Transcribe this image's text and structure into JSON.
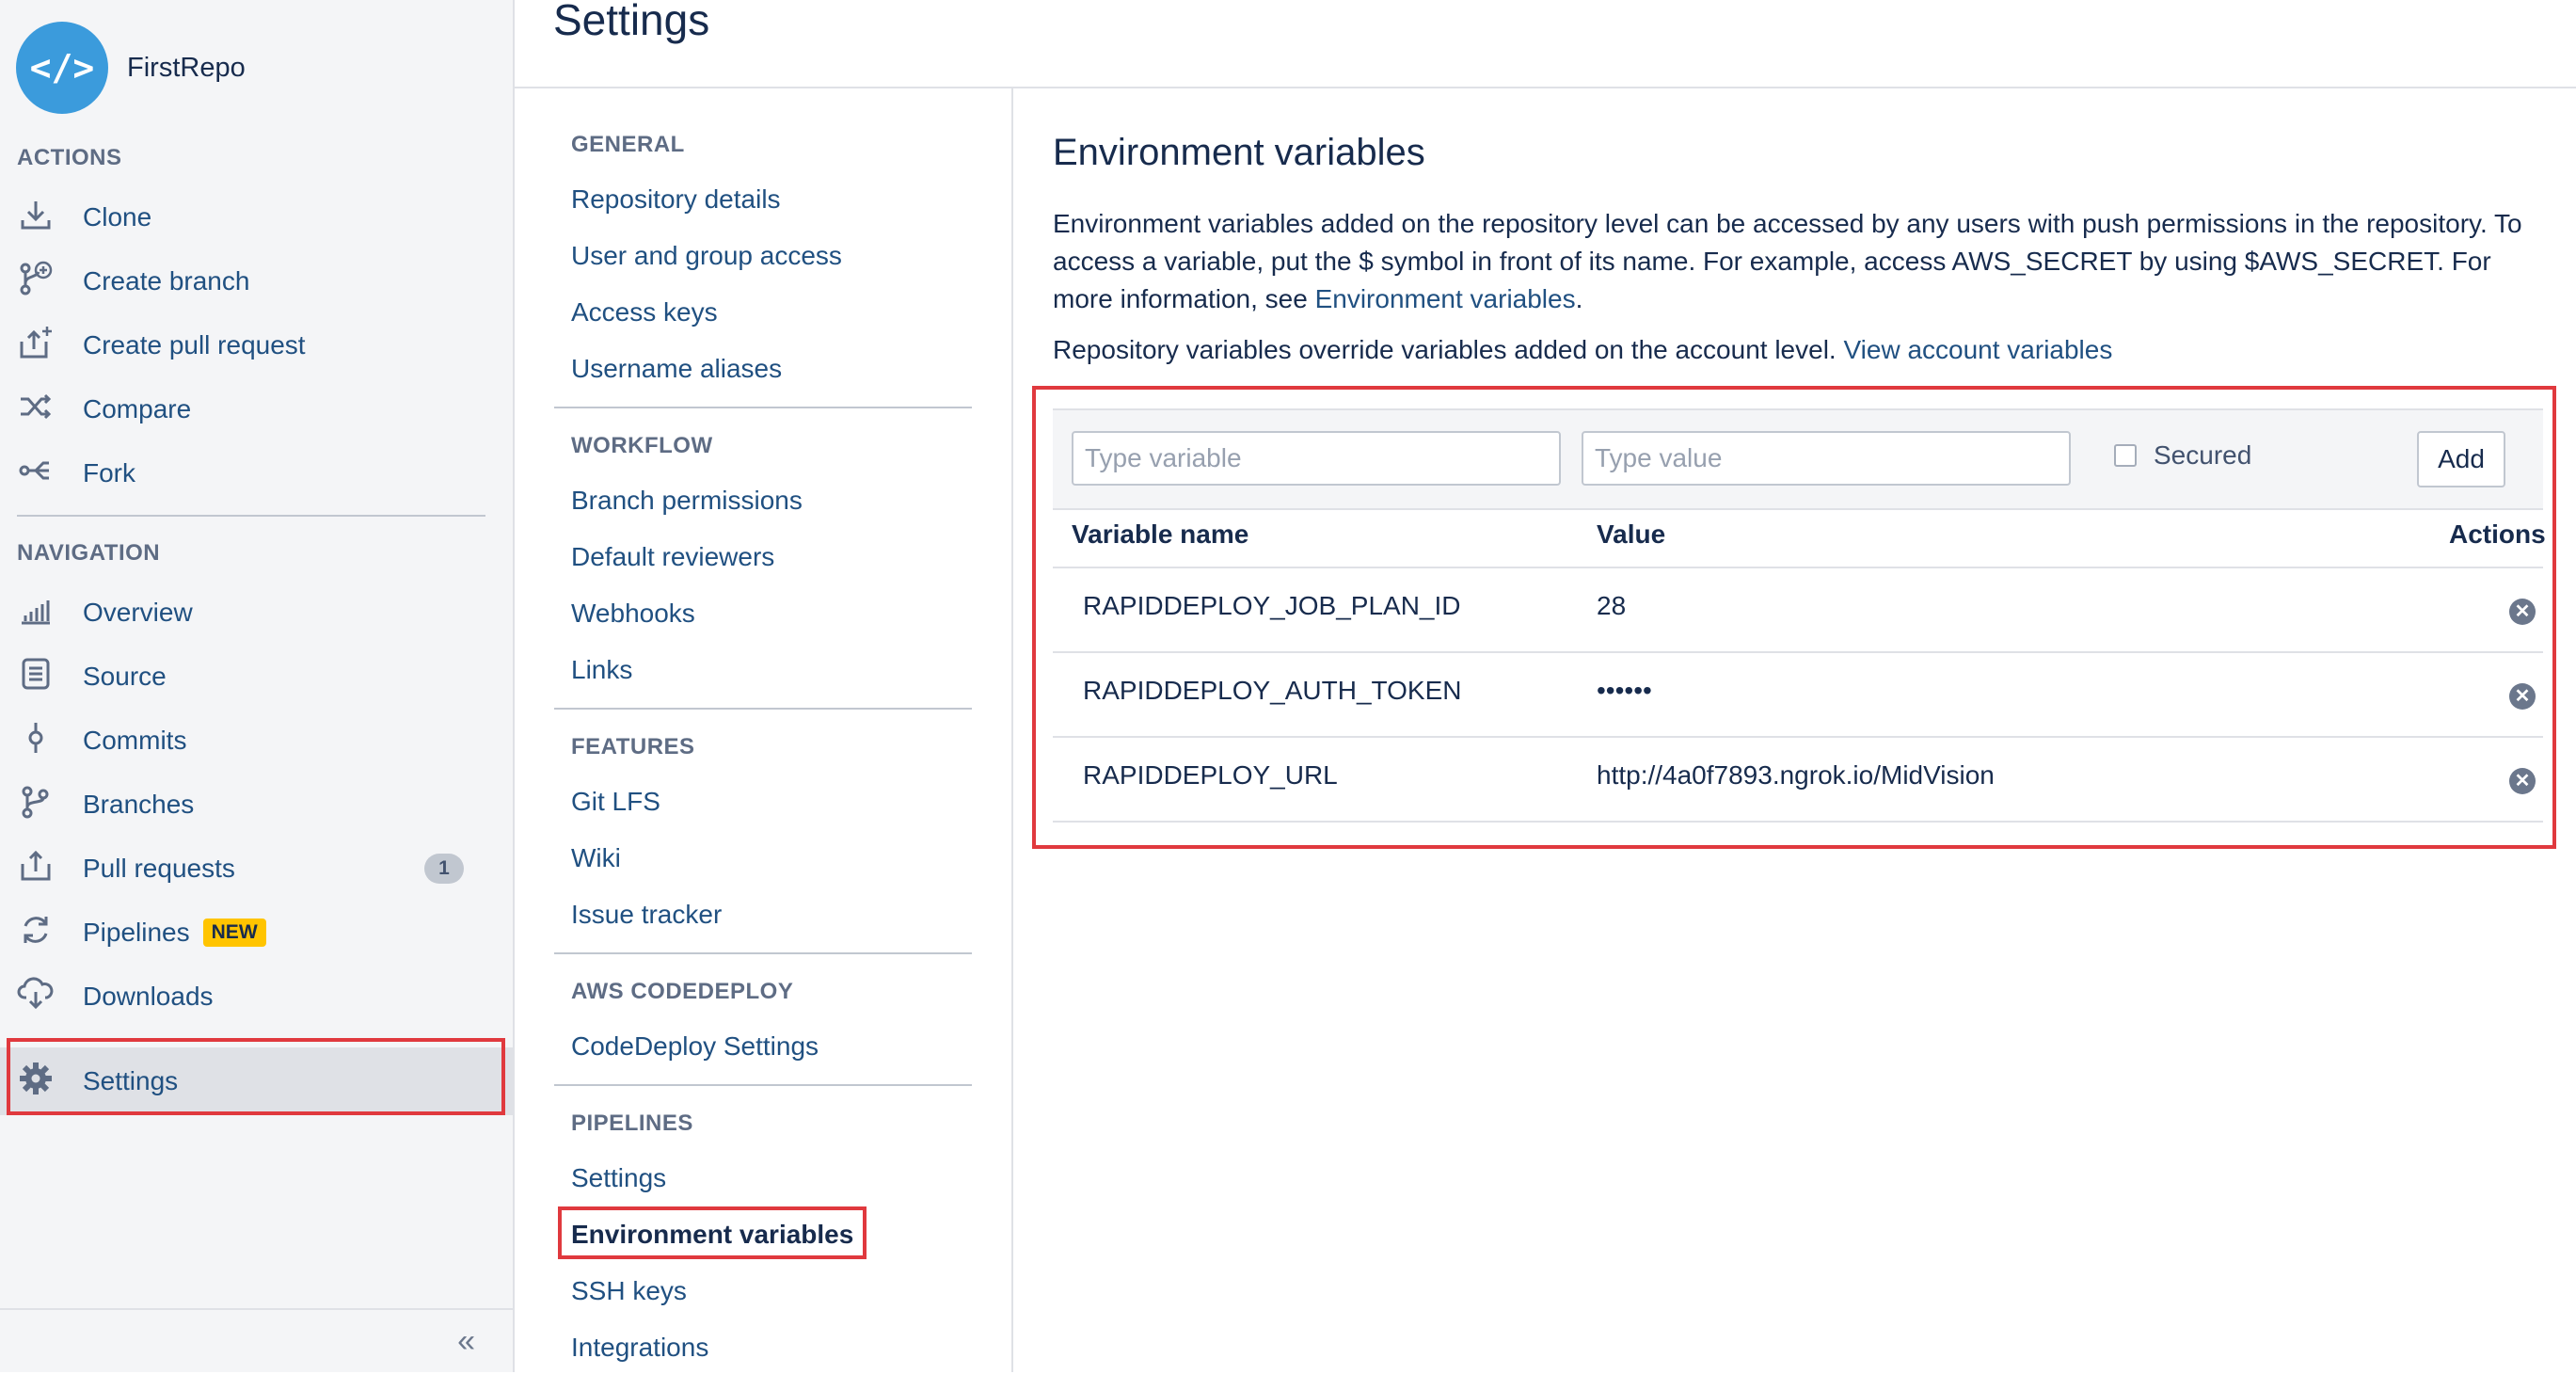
{
  "repo": {
    "name": "FirstRepo",
    "avatar_glyph": "</>"
  },
  "sidebar": {
    "actions_heading": "ACTIONS",
    "actions": [
      {
        "label": "Clone",
        "icon": "download-icon"
      },
      {
        "label": "Create branch",
        "icon": "branch-plus-icon"
      },
      {
        "label": "Create pull request",
        "icon": "pull-request-upload-icon"
      },
      {
        "label": "Compare",
        "icon": "shuffle-icon"
      },
      {
        "label": "Fork",
        "icon": "fork-icon"
      }
    ],
    "navigation_heading": "NAVIGATION",
    "navigation": [
      {
        "label": "Overview",
        "icon": "bar-chart-icon"
      },
      {
        "label": "Source",
        "icon": "document-icon"
      },
      {
        "label": "Commits",
        "icon": "commit-icon"
      },
      {
        "label": "Branches",
        "icon": "branches-icon"
      },
      {
        "label": "Pull requests",
        "icon": "pull-request-icon",
        "count": "1"
      },
      {
        "label": "Pipelines",
        "icon": "refresh-icon",
        "badge": "NEW"
      },
      {
        "label": "Downloads",
        "icon": "cloud-download-icon"
      },
      {
        "label": "Settings",
        "icon": "gear-icon"
      }
    ],
    "collapse_glyph": "«"
  },
  "page": {
    "title": "Settings"
  },
  "settings_nav": {
    "general_heading": "GENERAL",
    "general": [
      "Repository details",
      "User and group access",
      "Access keys",
      "Username aliases"
    ],
    "workflow_heading": "WORKFLOW",
    "workflow": [
      "Branch permissions",
      "Default reviewers",
      "Webhooks",
      "Links"
    ],
    "features_heading": "FEATURES",
    "features": [
      "Git LFS",
      "Wiki",
      "Issue tracker"
    ],
    "aws_heading": "AWS CODEDEPLOY",
    "aws": [
      "CodeDeploy Settings"
    ],
    "pipelines_heading": "PIPELINES",
    "pipelines": [
      "Settings",
      "Environment variables",
      "SSH keys",
      "Integrations"
    ]
  },
  "main": {
    "heading": "Environment variables",
    "desc_text": "Environment variables added on the repository level can be accessed by any users with push permissions in the repository. To access a variable, put the $ symbol in front of its name. For example, access AWS_SECRET by using $AWS_SECRET. For more information, see ",
    "desc_link": "Environment variables",
    "desc_end": ".",
    "override_text": "Repository variables override variables added on the account level. ",
    "override_link": "View account variables",
    "form": {
      "variable_placeholder": "Type variable",
      "value_placeholder": "Type value",
      "secured_label": "Secured",
      "add_label": "Add"
    },
    "table": {
      "headers": {
        "name": "Variable name",
        "value": "Value",
        "actions": "Actions"
      },
      "rows": [
        {
          "name": "RAPIDDEPLOY_JOB_PLAN_ID",
          "value": "28"
        },
        {
          "name": "RAPIDDEPLOY_AUTH_TOKEN",
          "value": "••••••"
        },
        {
          "name": "RAPIDDEPLOY_URL",
          "value": "http://4a0f7893.ngrok.io/MidVision"
        }
      ],
      "delete_glyph": "✕"
    }
  },
  "colors": {
    "link": "#205081",
    "highlight": "#e0393e",
    "badge": "#ffc400",
    "avatar": "#3b9bdc"
  }
}
